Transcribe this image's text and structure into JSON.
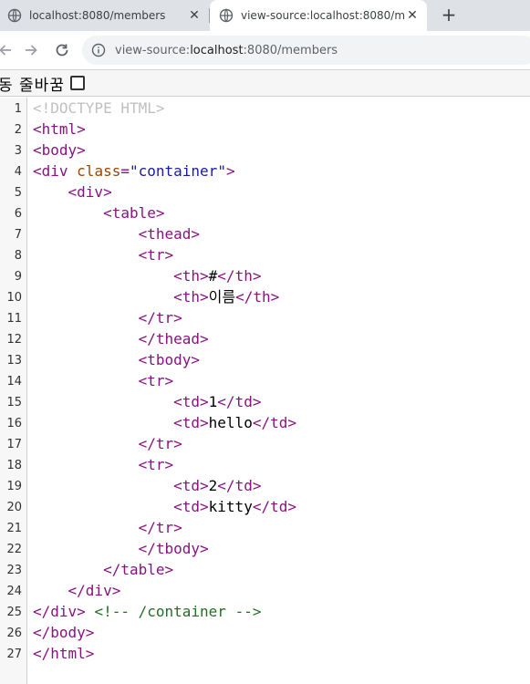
{
  "tabs": [
    {
      "title": "localhost:8080/members",
      "active": false
    },
    {
      "title": "view-source:localhost:8080/members",
      "active": true
    }
  ],
  "toolbar": {
    "url_prefix": "view-source:",
    "url_host": "localhost",
    "url_path": ":8080/members"
  },
  "wrap_label": "동 줄바꿈",
  "line_numbers": [
    "1",
    "2",
    "3",
    "4",
    "5",
    "6",
    "7",
    "8",
    "9",
    "10",
    "11",
    "12",
    "13",
    "14",
    "15",
    "16",
    "17",
    "18",
    "19",
    "20",
    "21",
    "22",
    "23",
    "24",
    "25",
    "26",
    "27"
  ],
  "source_lines": [
    [
      {
        "c": "doctype",
        "t": "<!DOCTYPE HTML>"
      }
    ],
    [
      {
        "c": "tag",
        "t": "<html>"
      }
    ],
    [
      {
        "c": "tag",
        "t": "<body>"
      }
    ],
    [
      {
        "c": "tag",
        "t": "<div "
      },
      {
        "c": "attr-name",
        "t": "class"
      },
      {
        "c": "tag",
        "t": "="
      },
      {
        "c": "attr-val",
        "t": "\"container\""
      },
      {
        "c": "tag",
        "t": ">"
      }
    ],
    [
      {
        "c": "txt",
        "t": "    "
      },
      {
        "c": "tag",
        "t": "<div>"
      }
    ],
    [
      {
        "c": "txt",
        "t": "        "
      },
      {
        "c": "tag",
        "t": "<table>"
      }
    ],
    [
      {
        "c": "txt",
        "t": "            "
      },
      {
        "c": "tag",
        "t": "<thead>"
      }
    ],
    [
      {
        "c": "txt",
        "t": "            "
      },
      {
        "c": "tag",
        "t": "<tr>"
      }
    ],
    [
      {
        "c": "txt",
        "t": "                "
      },
      {
        "c": "tag",
        "t": "<th>"
      },
      {
        "c": "txt",
        "t": "#"
      },
      {
        "c": "tag",
        "t": "</th>"
      }
    ],
    [
      {
        "c": "txt",
        "t": "                "
      },
      {
        "c": "tag",
        "t": "<th>"
      },
      {
        "c": "txt",
        "t": "이름"
      },
      {
        "c": "tag",
        "t": "</th>"
      }
    ],
    [
      {
        "c": "txt",
        "t": "            "
      },
      {
        "c": "tag",
        "t": "</tr>"
      }
    ],
    [
      {
        "c": "txt",
        "t": "            "
      },
      {
        "c": "tag",
        "t": "</thead>"
      }
    ],
    [
      {
        "c": "txt",
        "t": "            "
      },
      {
        "c": "tag",
        "t": "<tbody>"
      }
    ],
    [
      {
        "c": "txt",
        "t": "            "
      },
      {
        "c": "tag",
        "t": "<tr>"
      }
    ],
    [
      {
        "c": "txt",
        "t": "                "
      },
      {
        "c": "tag",
        "t": "<td>"
      },
      {
        "c": "txt",
        "t": "1"
      },
      {
        "c": "tag",
        "t": "</td>"
      }
    ],
    [
      {
        "c": "txt",
        "t": "                "
      },
      {
        "c": "tag",
        "t": "<td>"
      },
      {
        "c": "txt",
        "t": "hello"
      },
      {
        "c": "tag",
        "t": "</td>"
      }
    ],
    [
      {
        "c": "txt",
        "t": "            "
      },
      {
        "c": "tag",
        "t": "</tr>"
      }
    ],
    [
      {
        "c": "txt",
        "t": "            "
      },
      {
        "c": "tag",
        "t": "<tr>"
      }
    ],
    [
      {
        "c": "txt",
        "t": "                "
      },
      {
        "c": "tag",
        "t": "<td>"
      },
      {
        "c": "txt",
        "t": "2"
      },
      {
        "c": "tag",
        "t": "</td>"
      }
    ],
    [
      {
        "c": "txt",
        "t": "                "
      },
      {
        "c": "tag",
        "t": "<td>"
      },
      {
        "c": "txt",
        "t": "kitty"
      },
      {
        "c": "tag",
        "t": "</td>"
      }
    ],
    [
      {
        "c": "txt",
        "t": "            "
      },
      {
        "c": "tag",
        "t": "</tr>"
      }
    ],
    [
      {
        "c": "txt",
        "t": "            "
      },
      {
        "c": "tag",
        "t": "</tbody>"
      }
    ],
    [
      {
        "c": "txt",
        "t": "        "
      },
      {
        "c": "tag",
        "t": "</table>"
      }
    ],
    [
      {
        "c": "txt",
        "t": "    "
      },
      {
        "c": "tag",
        "t": "</div>"
      }
    ],
    [
      {
        "c": "tag",
        "t": "</div>"
      },
      {
        "c": "txt",
        "t": " "
      },
      {
        "c": "comment",
        "t": "<!-- /container -->"
      }
    ],
    [
      {
        "c": "tag",
        "t": "</body>"
      }
    ],
    [
      {
        "c": "tag",
        "t": "</html>"
      }
    ]
  ],
  "colors": {
    "tag": "#881280",
    "doctype": "#c0c0c0",
    "attr_name": "#994500",
    "attr_value": "#1a1aa6",
    "comment": "#236e25",
    "tabstrip_bg": "#dee1e6"
  }
}
